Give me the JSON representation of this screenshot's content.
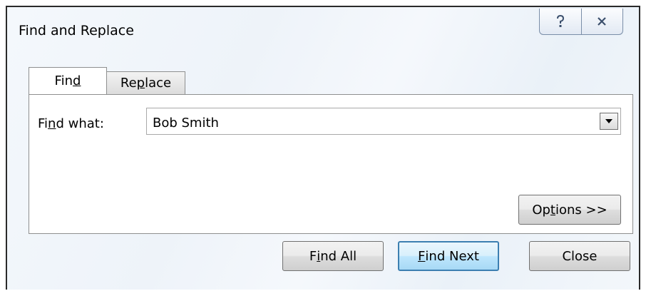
{
  "window": {
    "title": "Find and Replace",
    "help_glyph": "?",
    "close_glyph": "X"
  },
  "tabs": {
    "find": {
      "pre": "Fin",
      "mnemonic": "d",
      "post": ""
    },
    "replace": {
      "pre": "Re",
      "mnemonic": "p",
      "post": "lace"
    }
  },
  "find_what": {
    "label_pre": "Fi",
    "label_mnemonic": "n",
    "label_post": "d what:",
    "value": "Bob Smith"
  },
  "buttons": {
    "options": {
      "pre": "Op",
      "mnemonic": "t",
      "post": "ions >>"
    },
    "find_all": {
      "pre": "F",
      "mnemonic": "i",
      "post": "nd All"
    },
    "find_next": {
      "pre": "",
      "mnemonic": "F",
      "post": "ind Next"
    },
    "close": {
      "label": "Close"
    }
  },
  "colors": {
    "default_button_border": "#3c7fb1",
    "caption_icon": "#3b4f6c"
  }
}
